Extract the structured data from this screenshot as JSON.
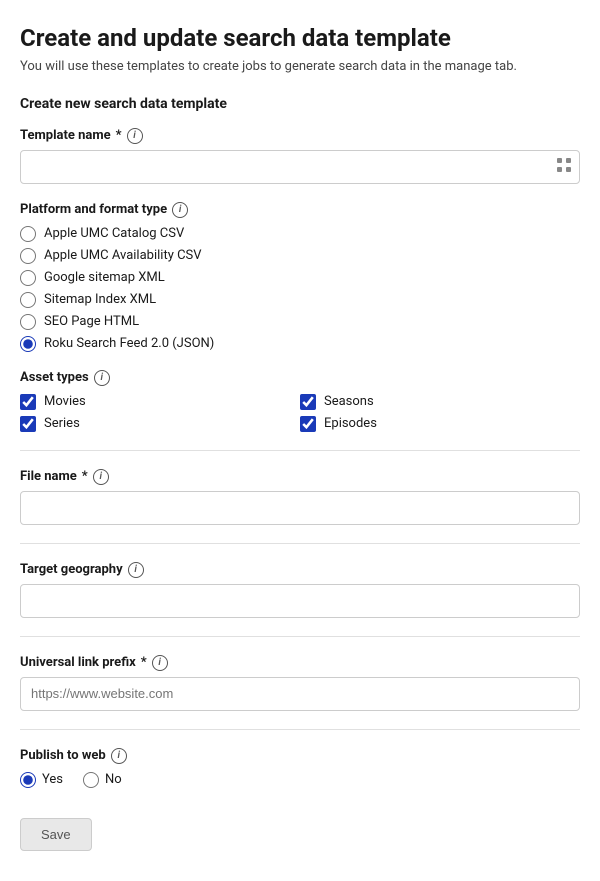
{
  "page": {
    "title": "Create and update search data template",
    "subtitle": "You will use these templates to create jobs to generate search data in the manage tab."
  },
  "section": {
    "create_title": "Create new search data template"
  },
  "template_name": {
    "label": "Template name",
    "required": true,
    "value": "",
    "placeholder": ""
  },
  "platform": {
    "label": "Platform and format type",
    "options": [
      {
        "id": "apple-umc-catalog",
        "label": "Apple UMC Catalog CSV",
        "checked": false
      },
      {
        "id": "apple-umc-availability",
        "label": "Apple UMC Availability CSV",
        "checked": false
      },
      {
        "id": "google-sitemap-xml",
        "label": "Google sitemap XML",
        "checked": false
      },
      {
        "id": "sitemap-index-xml",
        "label": "Sitemap Index XML",
        "checked": false
      },
      {
        "id": "seo-page-html",
        "label": "SEO Page HTML",
        "checked": false
      },
      {
        "id": "roku-search-feed",
        "label": "Roku Search Feed 2.0 (JSON)",
        "checked": true
      }
    ]
  },
  "asset_types": {
    "label": "Asset types",
    "items": [
      {
        "id": "movies",
        "label": "Movies",
        "checked": true
      },
      {
        "id": "seasons",
        "label": "Seasons",
        "checked": true
      },
      {
        "id": "series",
        "label": "Series",
        "checked": true
      },
      {
        "id": "episodes",
        "label": "Episodes",
        "checked": true
      }
    ]
  },
  "file_name": {
    "label": "File name",
    "required": true,
    "value": "",
    "placeholder": ""
  },
  "target_geography": {
    "label": "Target geography",
    "value": "",
    "placeholder": ""
  },
  "universal_link_prefix": {
    "label": "Universal link prefix",
    "required": true,
    "value": "",
    "placeholder": "https://www.website.com"
  },
  "publish_to_web": {
    "label": "Publish to web",
    "options": [
      {
        "id": "yes",
        "label": "Yes",
        "checked": true
      },
      {
        "id": "no",
        "label": "No",
        "checked": false
      }
    ]
  },
  "buttons": {
    "save": "Save"
  }
}
